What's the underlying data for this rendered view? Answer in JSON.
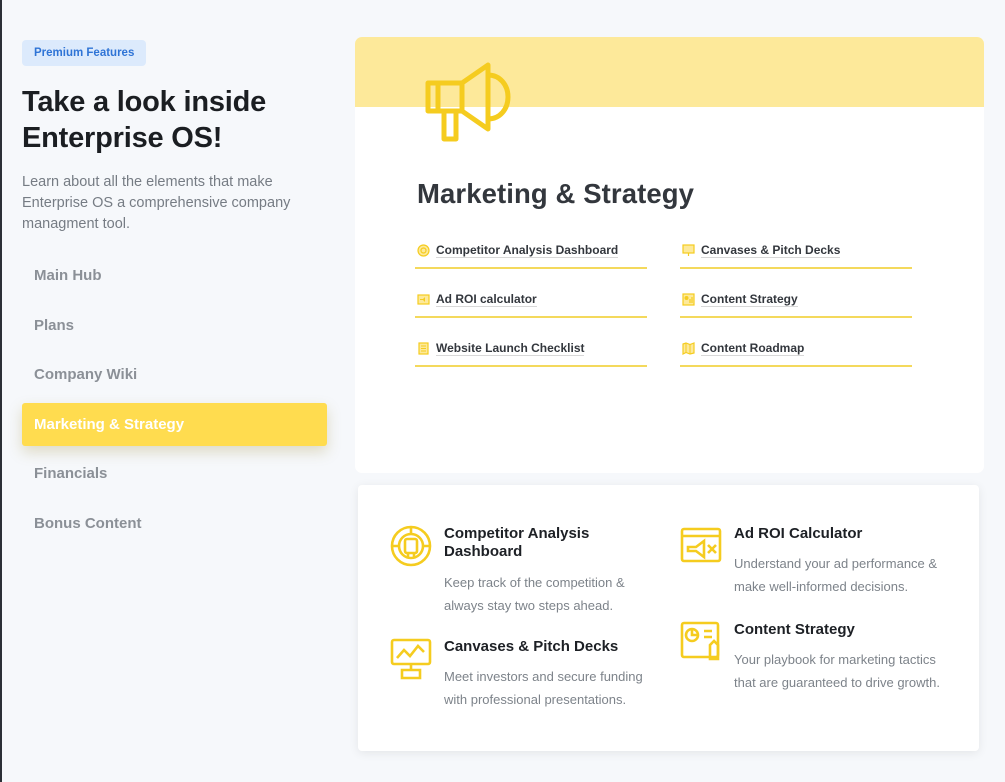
{
  "left": {
    "badge": "Premium Features",
    "headline_line1": "Take a look inside",
    "headline_line2": "Enterprise OS!",
    "lede": "Learn about all the elements that make Enterprise OS a comprehensive company managment tool."
  },
  "nav": {
    "items": [
      {
        "label": "Main Hub"
      },
      {
        "label": "Plans"
      },
      {
        "label": "Company Wiki"
      },
      {
        "label": "Marketing & Strategy"
      },
      {
        "label": "Financials"
      },
      {
        "label": "Bonus Content"
      }
    ],
    "active_index": 3
  },
  "top_card": {
    "icon": "megaphone-icon",
    "title": "Marketing & Strategy",
    "links": [
      {
        "label": "Competitor Analysis Dashboard",
        "icon": "target-icon"
      },
      {
        "label": "Canvases & Pitch Decks",
        "icon": "presentation-icon"
      },
      {
        "label": "Ad ROI calculator",
        "icon": "ad-icon"
      },
      {
        "label": "Content Strategy",
        "icon": "chart-icon"
      },
      {
        "label": "Website Launch Checklist",
        "icon": "checklist-icon"
      },
      {
        "label": "Content Roadmap",
        "icon": "roadmap-icon"
      }
    ]
  },
  "features": [
    {
      "title": "Competitor Analysis Dashboard",
      "desc": "Keep track of the competition & always stay two steps ahead.",
      "icon": "target-icon"
    },
    {
      "title": "Ad ROI Calculator",
      "desc": "Understand your ad performance & make well-informed decisions.",
      "icon": "ad-icon"
    },
    {
      "title": "Canvases & Pitch Decks",
      "desc": "Meet investors and secure funding with professional presentations.",
      "icon": "presentation-icon"
    },
    {
      "title": "Content Strategy",
      "desc": "Your playbook for marketing tactics that are guaranteed to drive growth.",
      "icon": "chart-icon"
    }
  ],
  "colors": {
    "accent": "#ffdc4f",
    "accent_light": "#fde99a",
    "icon_yellow": "#f5cc1f",
    "badge_bg": "#dceafc",
    "badge_text": "#2f74d6"
  }
}
